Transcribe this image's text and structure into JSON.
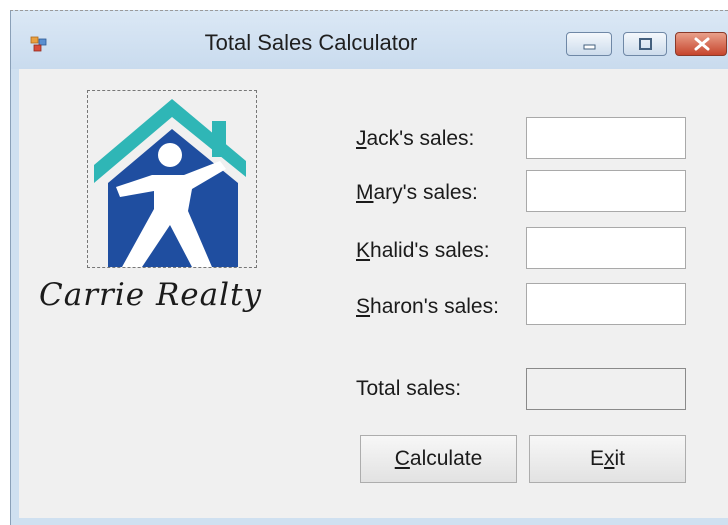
{
  "window": {
    "title": "Total Sales Calculator",
    "icon": "app-window-icon",
    "controls": [
      "minimize-icon",
      "maximize-icon",
      "close-icon"
    ]
  },
  "logo": {
    "image": "house-logo",
    "text": "Carrie Realty",
    "colors": {
      "roof": "#2fb6b6",
      "house": "#1f4ea0",
      "figure": "#ffffff"
    }
  },
  "fields": [
    {
      "label_access": "J",
      "label_rest": "ack's sales:",
      "value": ""
    },
    {
      "label_access": "M",
      "label_rest": "ary's sales:",
      "value": ""
    },
    {
      "label_access": "K",
      "label_rest": "halid's sales:",
      "value": ""
    },
    {
      "label_access": "S",
      "label_rest": "haron's sales:",
      "value": ""
    }
  ],
  "total": {
    "label": "Total sales:",
    "value": ""
  },
  "buttons": {
    "calculate": {
      "access": "C",
      "rest": "alculate"
    },
    "exit": {
      "pre": "E",
      "access": "x",
      "rest": "it"
    }
  }
}
